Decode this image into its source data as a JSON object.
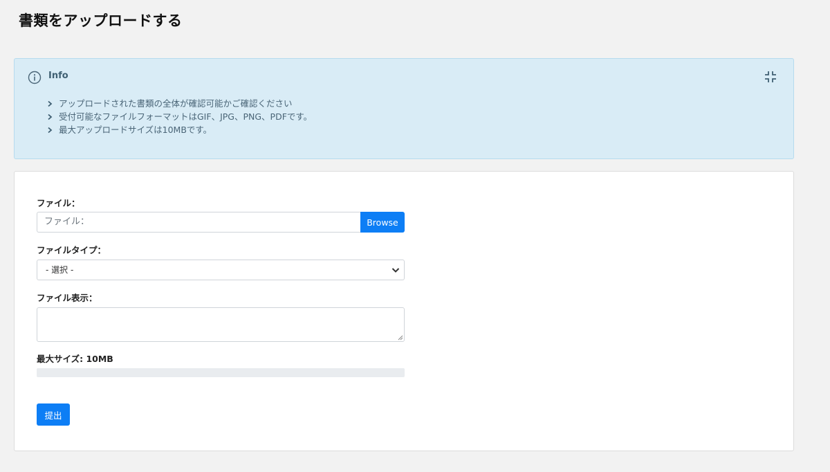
{
  "page": {
    "title": "書類をアップロードする"
  },
  "info": {
    "title": "Info",
    "icon": "info-circle-icon",
    "collapse_icon": "compress-icon",
    "items": [
      "アップロードされた書類の全体が確認可能かご確認ください",
      "受付可能なファイルフォーマットはGIF、JPG、PNG、PDFです。",
      "最大アップロードサイズは10MBです。"
    ]
  },
  "form": {
    "file_label": "ファイル：",
    "file_placeholder": "ファイル：",
    "browse_label": "Browse",
    "file_type_label": "ファイルタイプ：",
    "file_type_selected": "- 選択 -",
    "file_display_label": "ファイル表示：",
    "file_display_value": "",
    "max_size_label": "最大サイズ: 10MB",
    "upload_progress": 0,
    "submit_label": "提出"
  },
  "colors": {
    "primary": "#0d7ef5",
    "info_background": "#d9ecf6",
    "info_border": "#b6dbee",
    "page_background": "#f2f2f2",
    "progress_track": "#e9ecef"
  }
}
